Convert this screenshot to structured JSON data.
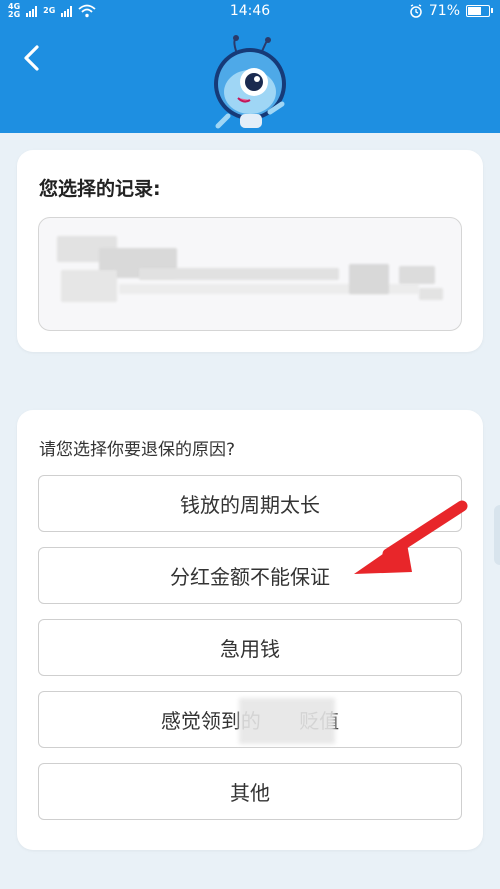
{
  "status_bar": {
    "network_top": "4G",
    "network_bottom": "2G",
    "network2_top": "2G",
    "time": "14:46",
    "battery": "71%",
    "battery_level": 0.71
  },
  "header": {
    "back_icon": "chevron-left-icon",
    "mascot_icon": "ant-mascot-icon"
  },
  "record_card": {
    "title": "您选择的记录:"
  },
  "reason_card": {
    "prompt": "请您选择你要退保的原因?",
    "options": [
      "钱放的周期太长",
      "分红金额不能保证",
      "急用钱",
      "感觉领到的      贬值",
      "其他"
    ]
  },
  "colors": {
    "header_bg": "#1e8fe1",
    "page_bg": "#e9f1f7",
    "arrow": "#e8262a"
  }
}
